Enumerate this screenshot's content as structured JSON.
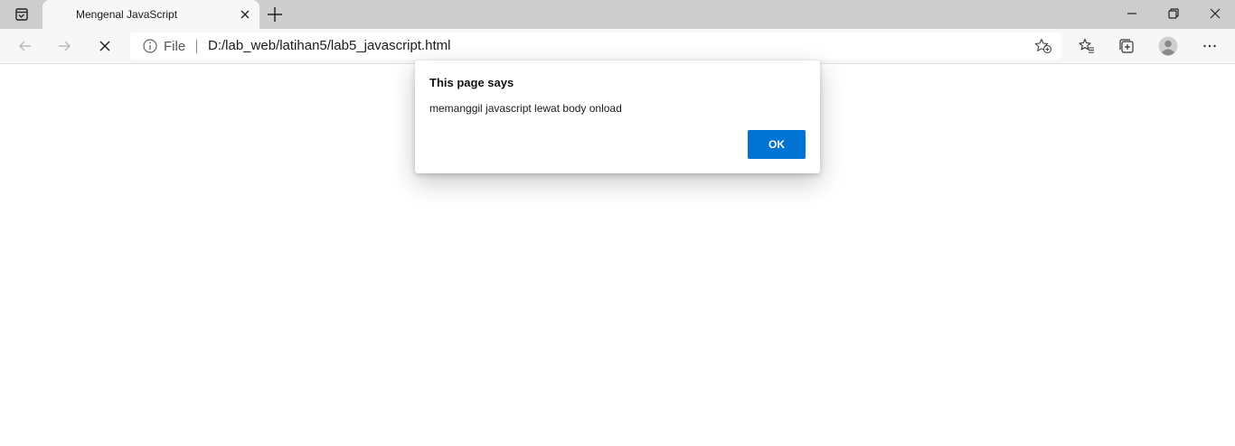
{
  "browser": {
    "tab": {
      "title": "Mengenal JavaScript"
    },
    "address_bar": {
      "scheme_label": "File",
      "url": "D:/lab_web/latihan5/lab5_javascript.html"
    },
    "icons": {
      "tab_actions": "tab-actions-icon",
      "close_tab": "close-icon",
      "new_tab": "plus-icon",
      "back": "arrow-left-icon",
      "forward": "arrow-right-icon",
      "stop": "stop-icon",
      "info": "info-icon",
      "add_favorite": "star-plus-icon",
      "favorites": "favorites-icon",
      "collections": "collections-icon",
      "profile": "avatar-icon",
      "more": "more-icon"
    }
  },
  "dialog": {
    "title": "This page says",
    "message": "memanggil javascript lewat body onload",
    "ok_label": "OK"
  },
  "colors": {
    "tabstrip_bg": "#cdcdcd",
    "toolbar_bg": "#f7f7f7",
    "accent": "#0074d2"
  }
}
